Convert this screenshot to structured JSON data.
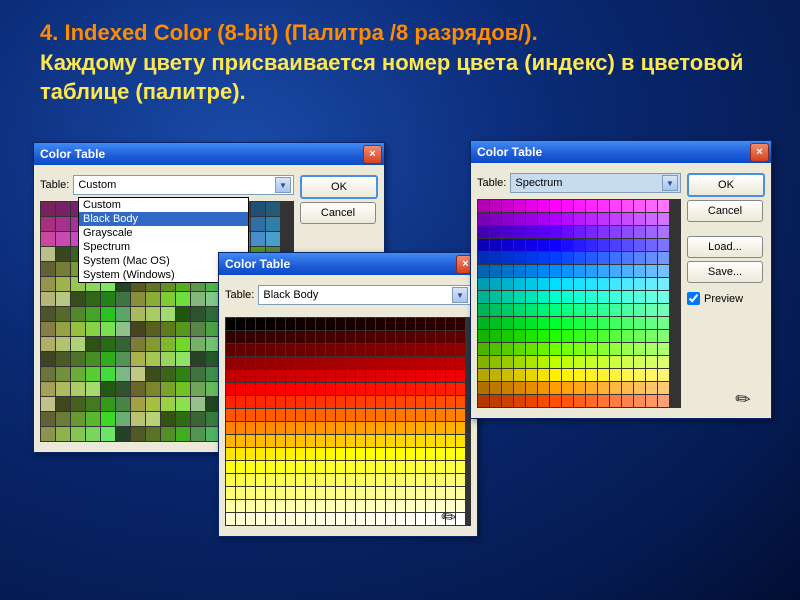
{
  "headline": {
    "number": "4.",
    "line1": "Indexed Color (8-bit) (Палитра /8 разрядов/).",
    "line2": "Каждому цвету присваивается номер цвета (индекс) в цветовой таблице (палитре)."
  },
  "window_title": "Color Table",
  "labels": {
    "table": "Table:",
    "ok": "OK",
    "cancel": "Cancel",
    "load": "Load...",
    "save": "Save...",
    "preview": "Preview"
  },
  "left_win": {
    "selected": "Custom",
    "options": [
      "Custom",
      "Black Body",
      "Grayscale",
      "Spectrum",
      "System (Mac OS)",
      "System (Windows)"
    ],
    "highlight": "Black Body"
  },
  "mid_win": {
    "selected": "Black Body"
  },
  "right_win": {
    "selected": "Spectrum"
  }
}
